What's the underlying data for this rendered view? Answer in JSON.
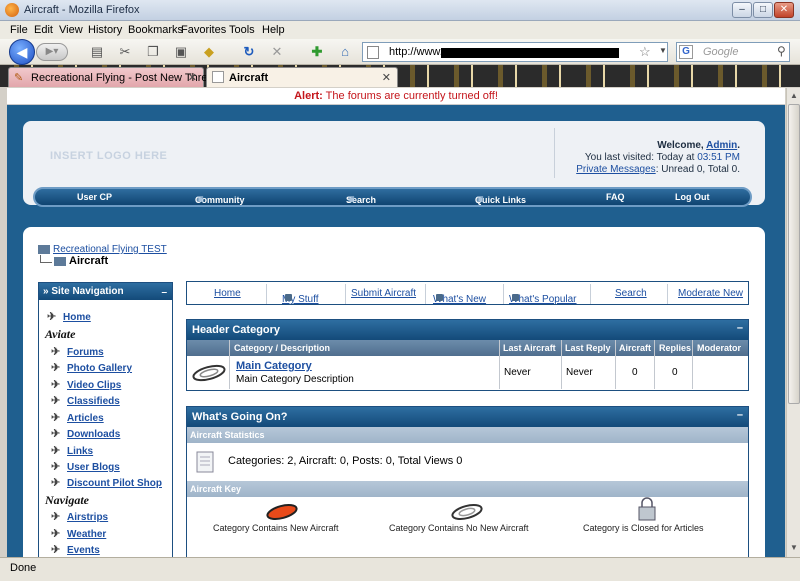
{
  "window": {
    "title": "Aircraft - Mozilla Firefox",
    "min": "–",
    "max": "□",
    "close": "✕"
  },
  "menu": [
    "File",
    "Edit",
    "View",
    "History",
    "Bookmarks",
    "Favorites",
    "Tools",
    "Help"
  ],
  "urlbar": {
    "prefix": "http://www."
  },
  "search": {
    "logo": "G",
    "placeholder": "Google"
  },
  "tabs": [
    {
      "label": "Recreational Flying - Post New Thre..."
    },
    {
      "label": "Aircraft"
    }
  ],
  "alert": {
    "label": "Alert:",
    "text": " The forums are currently turned off!"
  },
  "header": {
    "logo": "INSERT LOGO HERE",
    "welcome": "Welcome, ",
    "user": "Admin",
    "visited_prefix": "You last visited: Today at ",
    "visited_time": "03:51 PM",
    "pm_link": "Private Messages",
    "pm_text": ": Unread 0, Total 0."
  },
  "mainnav": [
    "User CP",
    "Community",
    "Search",
    "Quick Links",
    "FAQ",
    "Log Out"
  ],
  "breadcrumb": {
    "root": "Recreational Flying TEST",
    "current": "Aircraft"
  },
  "sidebar": {
    "title": "» Site Navigation",
    "collapse": "–",
    "home": "Home",
    "group1": "Aviate",
    "items1": [
      "Forums",
      "Photo Gallery",
      "Video Clips",
      "Classifieds",
      "Articles",
      "Downloads",
      "Links",
      "User Blogs",
      "Discount Pilot Shop"
    ],
    "group2": "Navigate",
    "items2": [
      "Airstrips",
      "Weather",
      "Events"
    ]
  },
  "quickbar": [
    "Home",
    "My Stuff",
    "Submit Aircraft",
    "What's New",
    "What's Popular",
    "Search",
    "Moderate New"
  ],
  "category_panel": {
    "title": "Header Category",
    "collapse": "–",
    "columns": [
      "Category / Description",
      "Last Aircraft",
      "Last Reply",
      "Aircraft",
      "Replies",
      "Moderator"
    ],
    "row": {
      "name": "Main Category",
      "desc": "Main Category Description",
      "last_aircraft": "Never",
      "last_reply": "Never",
      "aircraft": "0",
      "replies": "0",
      "moderator": ""
    }
  },
  "going_on": {
    "title": "What's Going On?",
    "collapse": "–",
    "stats_header": "Aircraft Statistics",
    "stats_text": "Categories: 2, Aircraft: 0, Posts: 0, Total Views 0",
    "key_header": "Aircraft Key",
    "keys": [
      "Category Contains New Aircraft",
      "Category Contains No New Aircraft",
      "Category is Closed for Articles"
    ]
  },
  "status": {
    "text": "Done"
  }
}
